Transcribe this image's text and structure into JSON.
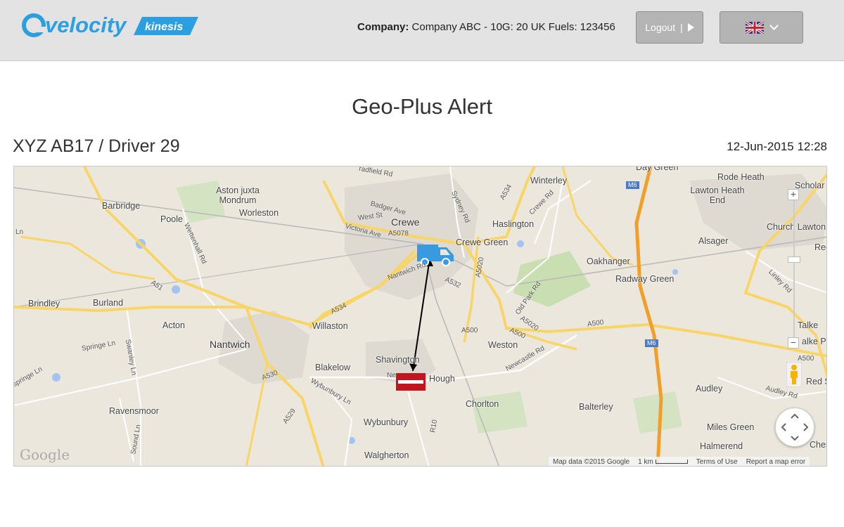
{
  "header": {
    "logo_brand": "velocity",
    "logo_tag": "kinesis",
    "company_label": "Company:",
    "company_value": "Company ABC - 10G: 20 UK Fuels: 123456",
    "logout_label": "Logout",
    "logout_separator": "|",
    "language_selected": "flag-uk-icon"
  },
  "page": {
    "title": "Geo-Plus Alert",
    "vehicle": "XYZ AB17 / Driver 29",
    "timestamp": "12-Jun-2015 12:28"
  },
  "map": {
    "places": {
      "crewe": "Crewe",
      "crewe_green": "Crewe Green",
      "haslington": "Haslington",
      "winterley": "Winterley",
      "rode_heath": "Rode Heath",
      "lawton_heath_end": "Lawton Heath End",
      "scholar": "Scholar",
      "church_lawton": "Church Lawton",
      "red_bull": "Red B",
      "alsager": "Alsager",
      "oakhanger": "Oakhanger",
      "radway_green": "Radway Green",
      "talke": "Talke",
      "talke_pits": "alke Pit",
      "red_street": "Red Str",
      "audley": "Audley",
      "balterley": "Balterley",
      "miles_green": "Miles Green",
      "halmerend": "Halmerend",
      "chesterton": "Ches",
      "aston": "Aston juxta Mondrum",
      "barbridge": "Barbridge",
      "poole": "Poole",
      "worleston": "Worleston",
      "brindley": "Brindley",
      "burland": "Burland",
      "acton": "Acton",
      "nantwich": "Nantwich",
      "willaston": "Willaston",
      "weston": "Weston",
      "shavington": "Shavington",
      "blakelow": "Blakelow",
      "hough": "Hough",
      "chorlton": "Chorlton",
      "ravensmoor": "Ravensmoor",
      "wybunbury": "Wybunbury",
      "walgherton": "Walgherton",
      "day_green": "Day Green",
      "bradfield_rd": "radfield Rd"
    },
    "roads": {
      "a5078": "A5078",
      "a534_n": "A534",
      "a534_w": "A534",
      "a5020_n": "A5020",
      "a5020_s": "A5020",
      "a532": "A532",
      "a500_1": "A500",
      "a500_2": "A500",
      "a500_3": "A500",
      "a500_4": "A500",
      "a51": "A51",
      "a530": "A530",
      "a529": "A529",
      "r10": "R10",
      "m6_n": "M6",
      "m6_s": "M6",
      "west_st": "West St",
      "badger_ave": "Badger Ave",
      "victoria_ave": "Victoria Ave",
      "sydney_rd": "Sydney Rd",
      "crewe_rd": "Crewe Rd",
      "nantwich_rd": "Nantwich Rd",
      "old_park_rd": "Old Park Rd",
      "newcastle_rd": "Newcastle Rd",
      "linley_rd": "Linley Rd",
      "audley_rd": "Audley Rd",
      "wettenhall_rd": "Wettenhall Rd",
      "springe_ln": "Springe Ln",
      "swanley_ln": "Swanley Ln",
      "wybunbury_ln": "Wybunbury Ln",
      "sound_ln": "Sound Ln",
      "ln": "Ln",
      "springe_ln_w": "springe Ln",
      "ne": "Ne"
    },
    "controls": {
      "zoom_in": "+",
      "zoom_out": "−"
    },
    "google": "Google",
    "attribution": {
      "map_data": "Map data ©2015 Google",
      "scale": "1 km",
      "terms": "Terms of Use",
      "report": "Report a map error"
    }
  }
}
